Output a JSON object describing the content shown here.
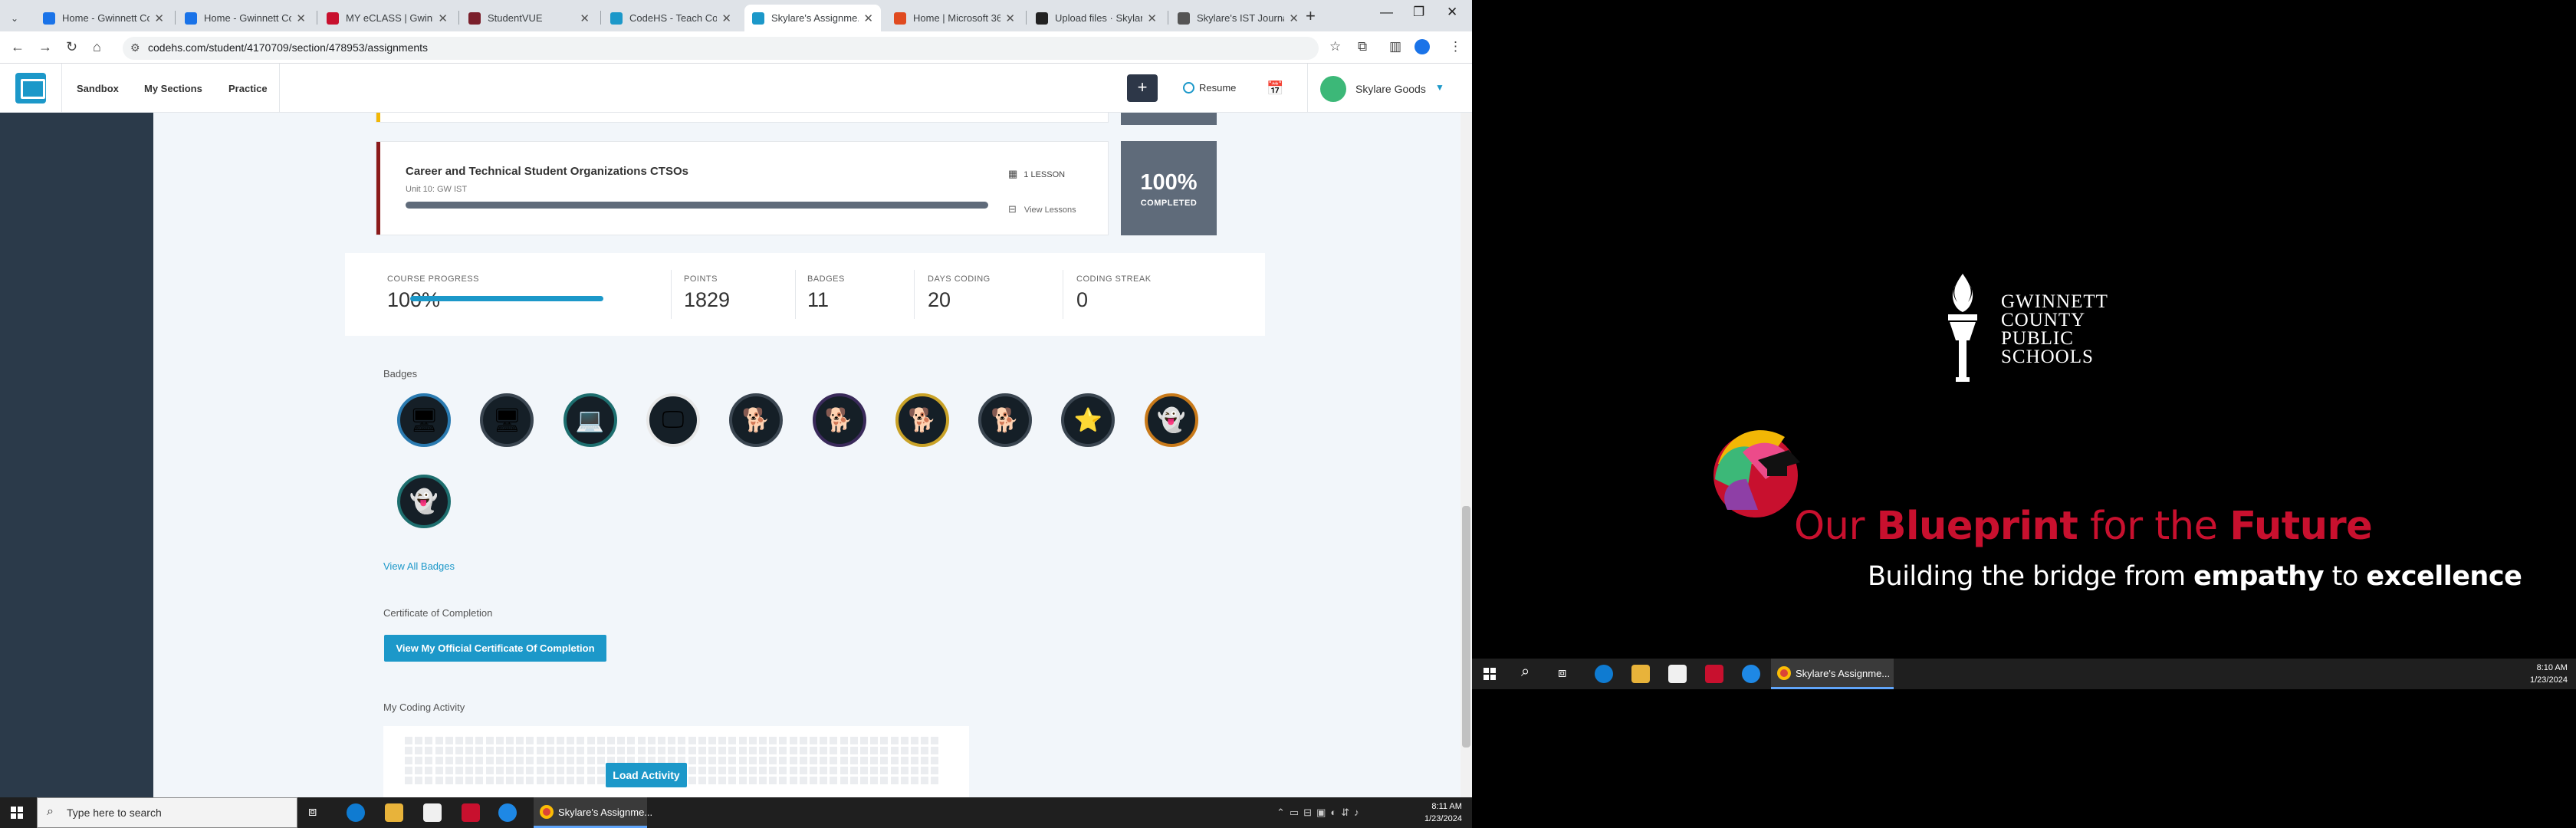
{
  "browser": {
    "tabs": [
      {
        "title": "Home - Gwinnett Co...",
        "color": "#1a73e8"
      },
      {
        "title": "Home - Gwinnett Co...",
        "color": "#1a73e8"
      },
      {
        "title": "MY eCLASS | Gwinn...",
        "color": "#c8102e"
      },
      {
        "title": "StudentVUE",
        "color": "#7a1f2b"
      },
      {
        "title": "CodeHS - Teach Codi...",
        "color": "#1c98c9"
      },
      {
        "title": "Skylare's Assignme...",
        "color": "#1c98c9",
        "active": true
      },
      {
        "title": "Home | Microsoft 36...",
        "color": "#e04a1f"
      },
      {
        "title": "Upload files · Skylar...",
        "color": "#222222"
      },
      {
        "title": "Skylare's IST Journal",
        "color": "#555555"
      }
    ],
    "url": "codehs.com/student/4170709/section/478953/assignments"
  },
  "codehs_nav": {
    "sandbox": "Sandbox",
    "my_sections": "My Sections",
    "practice": "Practice",
    "plus": "+",
    "resume": "Resume",
    "user_name": "Skylare Goods"
  },
  "units": [
    {
      "title": "Career and Technical Student Organizations CTSOs",
      "subtitle": "Unit 10: GW IST",
      "lessons": "1 LESSON",
      "view_lessons": "View Lessons",
      "percent": "100%",
      "completed": "COMPLETED",
      "progress": 1.0,
      "accent": "#8b1a1a"
    }
  ],
  "stats": {
    "course_progress_label": "COURSE PROGRESS",
    "course_progress_value": "100%",
    "course_progress_fraction": 1.0,
    "points_label": "POINTS",
    "points_value": "1829",
    "badges_label": "BADGES",
    "badges_value": "11",
    "days_coding_label": "DAYS CODING",
    "days_coding_value": "20",
    "coding_streak_label": "CODING STREAK",
    "coding_streak_value": "0"
  },
  "badges_section": {
    "heading": "Badges",
    "view_all": "View All Badges",
    "badges": [
      {
        "icon": "monitor-blue-icon",
        "glyph": "🖥",
        "ring": "#2a7ab0"
      },
      {
        "icon": "monitor-orange-icon",
        "glyph": "🖥",
        "ring": "#3a4550"
      },
      {
        "icon": "terminal-icon",
        "glyph": "💻",
        "ring": "#1d6e6e"
      },
      {
        "icon": "screen-white-icon",
        "glyph": "🖵",
        "ring": "#e8e8e8"
      },
      {
        "icon": "karel-dog-pink-icon",
        "glyph": "🐕",
        "ring": "#3a4550"
      },
      {
        "icon": "karel-dog-purple-icon",
        "glyph": "🐕",
        "ring": "#3a2a5a"
      },
      {
        "icon": "karel-dog-gold-icon",
        "glyph": "🐕",
        "ring": "#c9a227"
      },
      {
        "icon": "karel-dog-red-icon",
        "glyph": "🐕",
        "ring": "#3a4550"
      },
      {
        "icon": "karel-dog-star-icon",
        "glyph": "⭐",
        "ring": "#3a4550"
      },
      {
        "icon": "ghost-orange-icon",
        "glyph": "👻",
        "ring": "#c97a1a"
      },
      {
        "icon": "ghost-teal-icon",
        "glyph": "👻",
        "ring": "#1d6e6e"
      }
    ]
  },
  "certificate": {
    "heading": "Certificate of Completion",
    "button": "View My Official Certificate Of Completion"
  },
  "activity": {
    "heading": "My Coding Activity",
    "load_button": "Load Activity"
  },
  "taskbar_left": {
    "search_placeholder": "Type here to search",
    "chrome_label": "Skylare's Assignme...",
    "time": "8:11 AM",
    "date": "1/23/2024"
  },
  "wallpaper": {
    "gcps_line1": "GWINNETT",
    "gcps_line2": "COUNTY",
    "gcps_line3": "PUBLIC",
    "gcps_line4": "SCHOOLS",
    "title_pre": "Our ",
    "title_bold1": "Blueprint",
    "title_mid": " for the ",
    "title_bold2": "Future",
    "sub_pre": "Building the bridge from ",
    "sub_bold1": "empathy",
    "sub_mid": " to ",
    "sub_bold2": "excellence"
  },
  "taskbar_right": {
    "chrome_label": "Skylare's Assignme...",
    "time": "8:10 AM",
    "date": "1/23/2024"
  }
}
